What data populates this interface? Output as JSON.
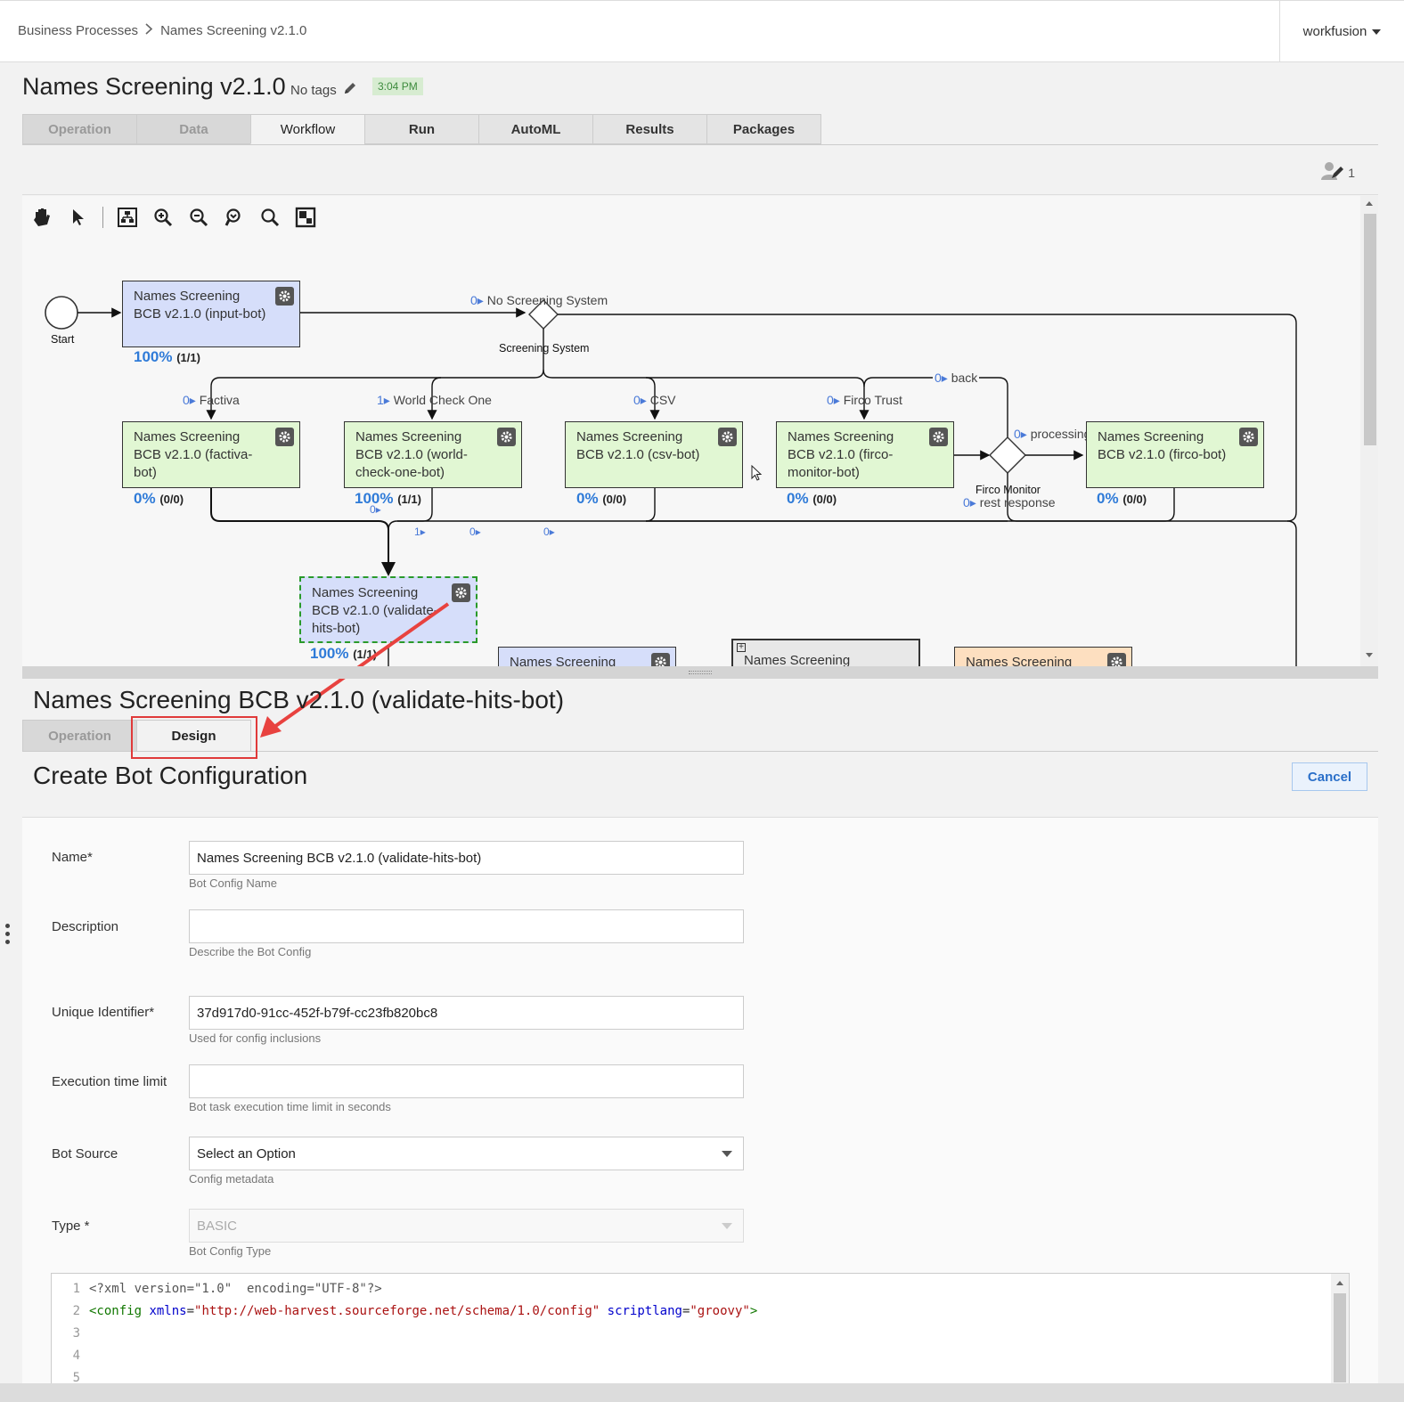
{
  "breadcrumb": {
    "root": "Business Processes",
    "current": "Names Screening v2.1.0"
  },
  "user": {
    "name": "workfusion"
  },
  "page": {
    "title": "Names Screening v2.1.0",
    "tags": "No tags",
    "time": "3:04 PM"
  },
  "tabs": [
    "Operation",
    "Data",
    "Workflow",
    "Run",
    "AutoML",
    "Results",
    "Packages"
  ],
  "active_tab": "Workflow",
  "editors_count": "1",
  "toolbar_icons": [
    "hand-pan-icon",
    "pointer-icon",
    "auto-layout-icon",
    "zoom-in-icon",
    "zoom-out-icon",
    "zoom-reset-icon",
    "zoom-fit-icon",
    "overview-map-icon"
  ],
  "workflow": {
    "start_label": "Start",
    "nodes": {
      "input": {
        "line1": "Names Screening",
        "line2": "BCB v2.1.0 (input-bot)",
        "pct": "100%",
        "count": "(1/1)"
      },
      "factiva": {
        "line1": "Names Screening",
        "line2": "BCB v2.1.0 (factiva-",
        "line3": "bot)",
        "pct": "0%",
        "count": "(0/0)"
      },
      "worldcheck": {
        "line1": "Names Screening",
        "line2": "BCB v2.1.0 (world-",
        "line3": "check-one-bot)",
        "pct": "100%",
        "count": "(1/1)"
      },
      "csv": {
        "line1": "Names Screening",
        "line2": "BCB v2.1.0 (csv-bot)",
        "pct": "0%",
        "count": "(0/0)"
      },
      "firco_monitor": {
        "line1": "Names Screening",
        "line2": "BCB v2.1.0 (firco-",
        "line3": "monitor-bot)",
        "pct": "0%",
        "count": "(0/0)"
      },
      "firco": {
        "line1": "Names Screening",
        "line2": "BCB v2.1.0 (firco-bot)",
        "pct": "0%",
        "count": "(0/0)"
      },
      "validate": {
        "line1": "Names Screening",
        "line2": "BCB v2.1.0 (validate-",
        "line3": "hits-bot)",
        "pct": "100%",
        "count": "(1/1)"
      },
      "partial1": {
        "line1": "Names Screening"
      },
      "partial2": {
        "line1": "Names Screening"
      },
      "partial3": {
        "line1": "Names Screening"
      }
    },
    "flows": {
      "no_screening": {
        "count": "0",
        "label": "No Screening System"
      },
      "factiva": {
        "count": "0",
        "label": "Factiva"
      },
      "world_check": {
        "count": "1",
        "label": "World Check One"
      },
      "csv": {
        "count": "0",
        "label": "CSV"
      },
      "firco_trust": {
        "count": "0",
        "label": "Firco Trust"
      },
      "back": {
        "count": "0",
        "label": "back"
      },
      "processing": {
        "count": "0",
        "label": "processing"
      },
      "rest_response": {
        "count": "0",
        "label": "rest response"
      },
      "merge_a": {
        "count": "0"
      },
      "merge_b": {
        "count": "1"
      },
      "merge_c": {
        "count": "0"
      },
      "merge_d": {
        "count": "0"
      }
    },
    "gateways": {
      "screening": "Screening System",
      "firco_monitor": "Firco Monitor"
    }
  },
  "panel": {
    "title": "Names Screening BCB v2.1.0 (validate-hits-bot)",
    "tabs": [
      "Operation",
      "Design"
    ],
    "active_tab": "Design",
    "form_title": "Create Bot Configuration",
    "cancel": "Cancel"
  },
  "form": {
    "name": {
      "label": "Name*",
      "value": "Names Screening BCB v2.1.0 (validate-hits-bot)",
      "hint": "Bot Config Name"
    },
    "description": {
      "label": "Description",
      "value": "",
      "hint": "Describe the Bot Config"
    },
    "uid": {
      "label": "Unique Identifier*",
      "value": "37d917d0-91cc-452f-b79f-cc23fb820bc8",
      "hint": "Used for config inclusions"
    },
    "exec_limit": {
      "label": "Execution time limit",
      "value": "",
      "hint": "Bot task execution time limit in seconds"
    },
    "bot_source": {
      "label": "Bot Source",
      "value": "Select an Option",
      "hint": "Config metadata"
    },
    "type": {
      "label": "Type *",
      "value": "BASIC",
      "hint": "Bot Config Type"
    }
  },
  "code": {
    "line_numbers": [
      "1",
      "2",
      "3",
      "4",
      "5"
    ],
    "line1": "<?xml version=\"1.0\"  encoding=\"UTF-8\"?>",
    "line2_tag": "<config",
    "line2_attr1": "xmlns",
    "line2_val1": "\"http://web-harvest.sourceforge.net/schema/1.0/config\"",
    "line2_attr2": "scriptlang",
    "line2_val2": "\"groovy\"",
    "line2_close": ">"
  },
  "colors": {
    "accent_blue": "#2f7bd8",
    "highlight_red": "#e03a3a",
    "node_blue": "#d6defa",
    "node_green": "#e1f7d3",
    "node_orange": "#fddfc0",
    "time_badge": "#d7ecd1"
  }
}
